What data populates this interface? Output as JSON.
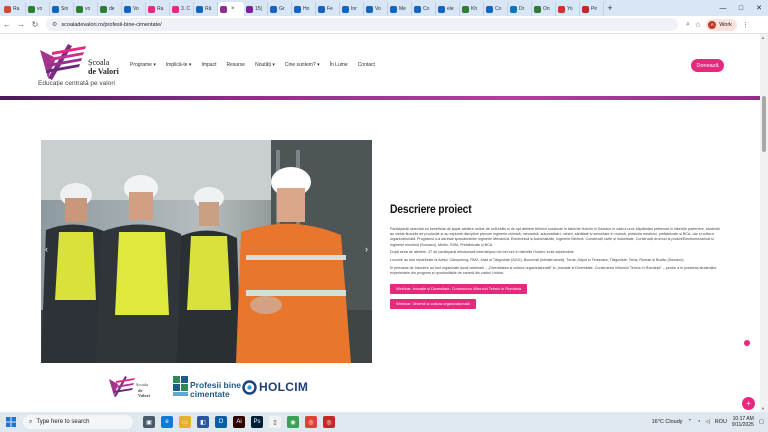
{
  "browser": {
    "tabs": [
      {
        "label": "Ra",
        "color": "#db4437"
      },
      {
        "label": "vo",
        "color": "#2e7d32"
      },
      {
        "label": "Sin",
        "color": "#1565c0"
      },
      {
        "label": "vo",
        "color": "#2e7d32"
      },
      {
        "label": "de",
        "color": "#2e7d32"
      },
      {
        "label": "Vo",
        "color": "#1565c0"
      },
      {
        "label": "Ra",
        "color": "#e7287d"
      },
      {
        "label": "3. C",
        "color": "#e7287d"
      },
      {
        "label": "Rã",
        "color": "#1565c0"
      },
      {
        "label": "",
        "color": "#8e2f8e",
        "active": true
      },
      {
        "label": "15(",
        "color": "#7b1fa2"
      },
      {
        "label": "Gr",
        "color": "#1565c0"
      },
      {
        "label": "Ho",
        "color": "#1565c0"
      },
      {
        "label": "Fe",
        "color": "#1565c0"
      },
      {
        "label": "Inr",
        "color": "#1565c0"
      },
      {
        "label": "Vo",
        "color": "#1565c0"
      },
      {
        "label": "Me",
        "color": "#1565c0"
      },
      {
        "label": "Co",
        "color": "#1565c0"
      },
      {
        "label": "ele",
        "color": "#1565c0"
      },
      {
        "label": "Kh",
        "color": "#2e7d32"
      },
      {
        "label": "Co",
        "color": "#1565c0"
      },
      {
        "label": "Dr",
        "color": "#0277bd"
      },
      {
        "label": "On",
        "color": "#2e7d32"
      },
      {
        "label": "Yo",
        "color": "#d32f2f"
      },
      {
        "label": "Pir",
        "color": "#c62828"
      }
    ],
    "new_tab": "+",
    "window_controls": [
      "—",
      "□",
      "✕"
    ],
    "url": "scoaladevalori.ro/profesii-bine-cimentate/",
    "profile": {
      "initial": "A",
      "label": "Work"
    }
  },
  "site": {
    "logo_line1": "Școala",
    "logo_line2": "de Valori",
    "tagline": "Educație centrată pe valori",
    "menu": [
      {
        "label": "Programe",
        "dropdown": true
      },
      {
        "label": "Implică-te",
        "dropdown": true
      },
      {
        "label": "Impact",
        "dropdown": false
      },
      {
        "label": "Resurse",
        "dropdown": false
      },
      {
        "label": "Noutăți",
        "dropdown": true
      },
      {
        "label": "Cine suntem?",
        "dropdown": true
      },
      {
        "label": "În Lume",
        "dropdown": false
      },
      {
        "label": "Contact",
        "dropdown": false
      }
    ],
    "donate": "Donează"
  },
  "slider": {
    "prev": "‹",
    "next": "›"
  },
  "content": {
    "heading": "Descriere proiect",
    "paragraphs": [
      "Participanții selectați au beneficiat de șapte ateliere online de soft-skills și de opt ateliere tehnice susținute în fabricile Holcim și Somaco în cadrul unor săptămâni petrecute în fabricile partenere, studenții au vizitat fluxurile de producție și au explorat discipline precum inginerie chimică, mecanică, automatizări, mineri, sănătate și securitate în muncă, protecția mediului, prefabricate și BCA, dar și cultura organizațională. Programul s-a adresat specializărilor Inginerie Mecanică, Electronică și Automatizări, Inginerie Minieră, Construcții civile și industriale, Construcții drumuri și poduri/Electromecanică și Inginerie electrică (Somaco), Mediu, SSM, Prefabricate și BCA.",
      "După seria de ateliere, 37 de participanți efectuează internshipuri de trei luni în fabricile Holcim: iunie-septembrie",
      "Locurile au fost repartizate la Aleșd, Câmpulung, RMX, Arad și Târgoviște (AGG), București (infrastructură), Turda, Adjud și Timișoara, Târgoviște, Teiuș, Roman și Buzău (Somaco).",
      "În perioada de înscriere au fost organizate două webinarii – „Diversitatea și cultura organizațională” și „Inovație și Diversitate. Construirea Viitorului Tehnic în România” – pentru a le prezenta studenților experiențele din program și oportunitățile de carieră din cadrul Holcim."
    ],
    "buttons": [
      "Webinar: Inovație și Diversitate. Construirea Viitorului Tehnic în România",
      "Webinar: Diversit și cultura organizațională"
    ]
  },
  "partners": {
    "sv_line1": "Școala",
    "sv_line2": "de Valori",
    "pbc_line1": "Profesii bine",
    "pbc_line2": "cimentate",
    "holcim": "HOLCIM"
  },
  "fab": "+",
  "taskbar": {
    "search_placeholder": "Type here to search",
    "weather": "16°C  Cloudy",
    "lang": "ROU",
    "time": "10:17 AM",
    "date": "9/11/2025"
  },
  "colors": {
    "brand_pink": "#e7287d",
    "brand_purple": "#8e2f8e",
    "holcim_blue": "#1d3f7a"
  }
}
